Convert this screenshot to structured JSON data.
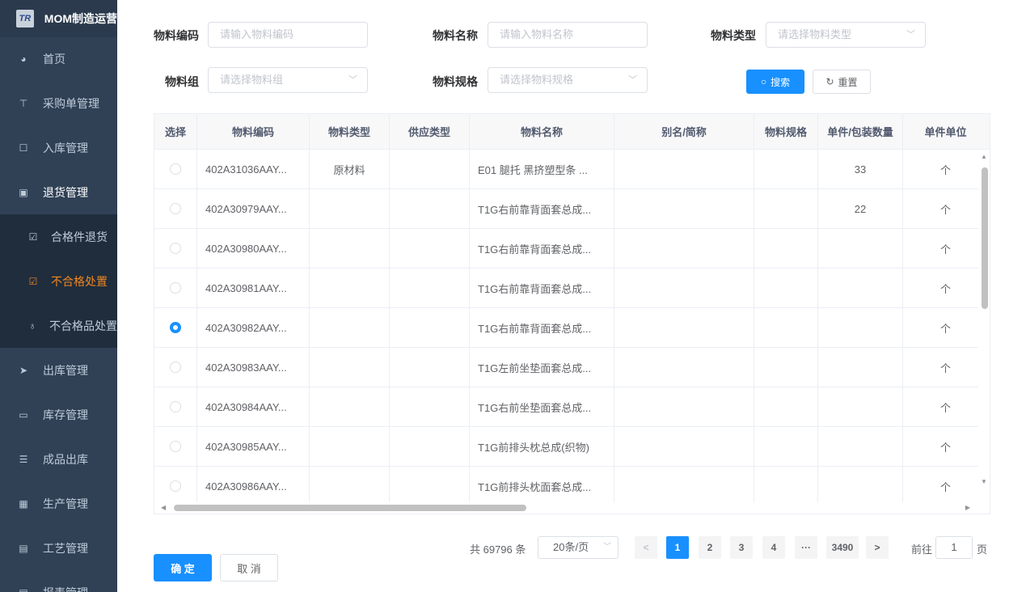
{
  "sidebar": {
    "brand_logo": "TR",
    "brand_title": "MOM制造运营",
    "items": [
      {
        "label": "首页",
        "icon": "dashboard-icon"
      },
      {
        "label": "采购单管理",
        "icon": "cart-icon"
      },
      {
        "label": "入库管理",
        "icon": "edit-icon"
      },
      {
        "label": "退货管理",
        "icon": "monitor-icon"
      },
      {
        "label": "出库管理",
        "icon": "send-icon"
      },
      {
        "label": "库存管理",
        "icon": "monitor-icon"
      },
      {
        "label": "成品出库",
        "icon": "list-icon"
      },
      {
        "label": "生产管理",
        "icon": "screen-icon"
      },
      {
        "label": "工艺管理",
        "icon": "doc-icon"
      },
      {
        "label": "报表管理",
        "icon": "doc-icon"
      }
    ],
    "submenu": [
      {
        "label": "合格件退货",
        "icon": "edit-icon"
      },
      {
        "label": "不合格处置",
        "icon": "edit-icon"
      },
      {
        "label": "不合格品处置",
        "icon": "hand-icon"
      }
    ]
  },
  "search": {
    "code_label": "物料编码",
    "code_placeholder": "请输入物料编码",
    "name_label": "物料名称",
    "name_placeholder": "请输入物料名称",
    "type_label": "物料类型",
    "type_placeholder": "请选择物料类型",
    "group_label": "物料组",
    "group_placeholder": "请选择物料组",
    "spec_label": "物料规格",
    "spec_placeholder": "请选择物料规格",
    "search_btn": "搜索",
    "reset_btn": "重置"
  },
  "table": {
    "headers": [
      "选择",
      "物料编码",
      "物料类型",
      "供应类型",
      "物料名称",
      "别名/简称",
      "物料规格",
      "单件/包装数量",
      "单件单位"
    ],
    "rows": [
      {
        "checked": false,
        "code": "402A31036AAY...",
        "type": "原材料",
        "supply": "",
        "name": "E01 腿托 黑挤塑型条 ...",
        "alias": "",
        "spec": "",
        "qty": "33",
        "unit": "个"
      },
      {
        "checked": false,
        "code": "402A30979AAY...",
        "type": "",
        "supply": "",
        "name": "T1G右前靠背面套总成...",
        "alias": "",
        "spec": "",
        "qty": "22",
        "unit": "个"
      },
      {
        "checked": false,
        "code": "402A30980AAY...",
        "type": "",
        "supply": "",
        "name": "T1G右前靠背面套总成...",
        "alias": "",
        "spec": "",
        "qty": "",
        "unit": "个"
      },
      {
        "checked": false,
        "code": "402A30981AAY...",
        "type": "",
        "supply": "",
        "name": "T1G右前靠背面套总成...",
        "alias": "",
        "spec": "",
        "qty": "",
        "unit": "个"
      },
      {
        "checked": true,
        "code": "402A30982AAY...",
        "type": "",
        "supply": "",
        "name": "T1G右前靠背面套总成...",
        "alias": "",
        "spec": "",
        "qty": "",
        "unit": "个"
      },
      {
        "checked": false,
        "code": "402A30983AAY...",
        "type": "",
        "supply": "",
        "name": "T1G左前坐垫面套总成...",
        "alias": "",
        "spec": "",
        "qty": "",
        "unit": "个"
      },
      {
        "checked": false,
        "code": "402A30984AAY...",
        "type": "",
        "supply": "",
        "name": "T1G右前坐垫面套总成...",
        "alias": "",
        "spec": "",
        "qty": "",
        "unit": "个"
      },
      {
        "checked": false,
        "code": "402A30985AAY...",
        "type": "",
        "supply": "",
        "name": "T1G前排头枕总成(织物)",
        "alias": "",
        "spec": "",
        "qty": "",
        "unit": "个"
      },
      {
        "checked": false,
        "code": "402A30986AAY...",
        "type": "",
        "supply": "",
        "name": "T1G前排头枕面套总成...",
        "alias": "",
        "spec": "",
        "qty": "",
        "unit": "个"
      }
    ]
  },
  "pagination": {
    "total_text": "共 69796 条",
    "page_size": "20条/页",
    "prev": "<",
    "pages": [
      "1",
      "2",
      "3",
      "4",
      "···",
      "3490"
    ],
    "next": ">",
    "goto_label": "前往",
    "goto_value": "1",
    "page_suffix": "页"
  },
  "footer": {
    "confirm": "确 定",
    "cancel": "取 消"
  },
  "colors": {
    "primary": "#1890ff",
    "sidebar_bg": "#304156",
    "active_menu": "#f0871f"
  }
}
